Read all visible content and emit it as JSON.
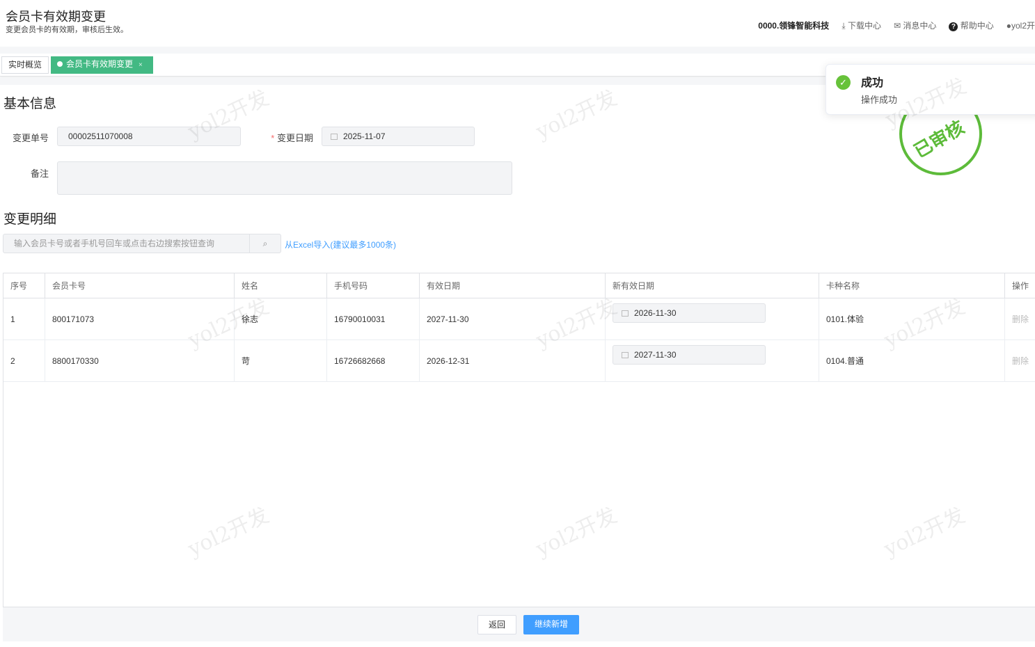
{
  "header": {
    "title": "会员卡有效期变更",
    "subtitle": "变更会员卡的有效期，审核后生效。",
    "company": "0000.领锋智能科技",
    "download": "下载中心",
    "messages": "消息中心",
    "help": "帮助中心",
    "user": "yol2开"
  },
  "tabs": [
    {
      "label": "实时概览"
    },
    {
      "label": "会员卡有效期变更",
      "close": "×"
    }
  ],
  "basic": {
    "section": "基本信息",
    "order_label": "变更单号",
    "order_value": "00002511070008",
    "date_required": "*",
    "date_label": "变更日期",
    "date_value": "2025-11-07",
    "remark_label": "备注",
    "remark_value": ""
  },
  "detail": {
    "section": "变更明细",
    "search_placeholder": "输入会员卡号或者手机号回车或点击右边搜索按钮查询",
    "import_link": "从Excel导入(建议最多1000条)"
  },
  "table": {
    "headers": [
      "序号",
      "会员卡号",
      "姓名",
      "手机号码",
      "有效日期",
      "新有效日期",
      "卡种名称",
      "操作"
    ],
    "rows": [
      {
        "no": "1",
        "card": "800171073",
        "name": "徐志",
        "phone": "16790010031",
        "expire": "2027-11-30",
        "new_expire": "2026-11-30",
        "type": "0101.体验",
        "action": "删除"
      },
      {
        "no": "2",
        "card": "8800170330",
        "name": "苛",
        "phone": "16726682668",
        "expire": "2026-12-31",
        "new_expire": "2027-11-30",
        "type": "0104.普通",
        "action": "删除"
      }
    ]
  },
  "footer": {
    "back": "返回",
    "continue": "继续新增"
  },
  "toast": {
    "title": "成功",
    "message": "操作成功"
  },
  "stamp": "已审核",
  "watermark": "yol2开发",
  "colors": {
    "accent": "#42b983",
    "primary": "#409eff",
    "success": "#67c23a"
  }
}
